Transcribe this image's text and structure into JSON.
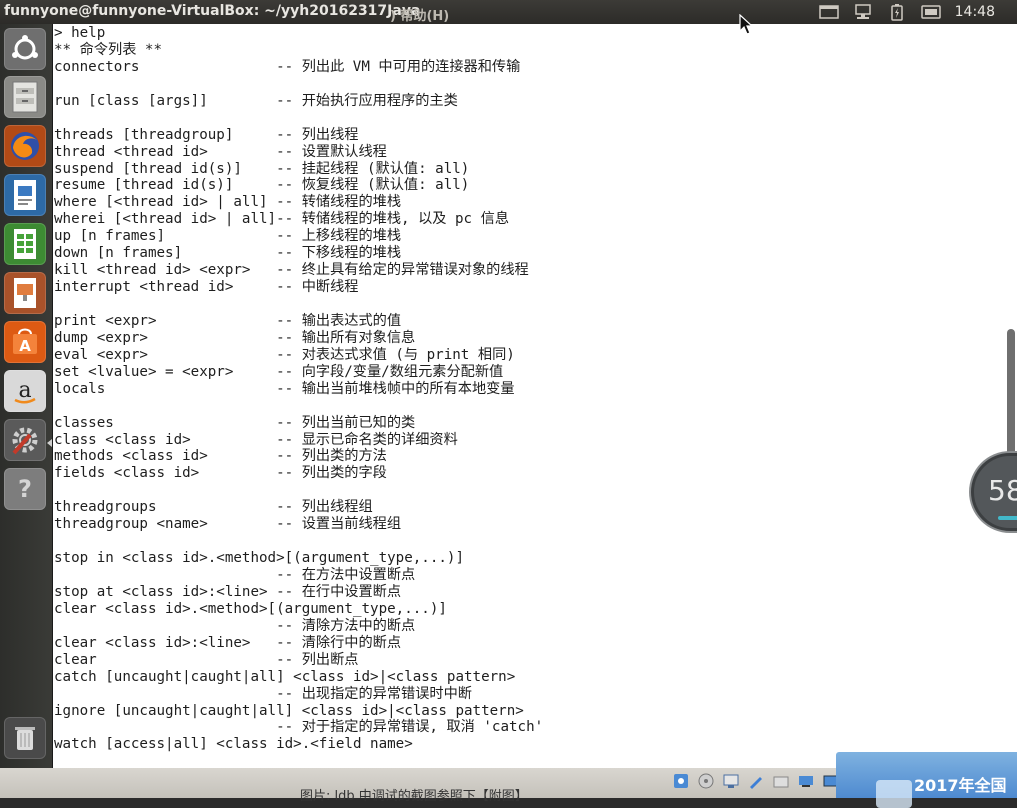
{
  "topbar": {
    "window_title": "funnyone@funnyone-VirtualBox: ~/yyh20162317Java",
    "menu_ghost": ") 帮助(H)",
    "clock": "14:48"
  },
  "terminal": {
    "lines": [
      "> help",
      "** 命令列表 **",
      "connectors                -- 列出此 VM 中可用的连接器和传输",
      "",
      "run [class [args]]        -- 开始执行应用程序的主类",
      "",
      "threads [threadgroup]     -- 列出线程",
      "thread <thread id>        -- 设置默认线程",
      "suspend [thread id(s)]    -- 挂起线程 (默认值: all)",
      "resume [thread id(s)]     -- 恢复线程 (默认值: all)",
      "where [<thread id> | all] -- 转储线程的堆栈",
      "wherei [<thread id> | all]-- 转储线程的堆栈, 以及 pc 信息",
      "up [n frames]             -- 上移线程的堆栈",
      "down [n frames]           -- 下移线程的堆栈",
      "kill <thread id> <expr>   -- 终止具有给定的异常错误对象的线程",
      "interrupt <thread id>     -- 中断线程",
      "",
      "print <expr>              -- 输出表达式的值",
      "dump <expr>               -- 输出所有对象信息",
      "eval <expr>               -- 对表达式求值 (与 print 相同)",
      "set <lvalue> = <expr>     -- 向字段/变量/数组元素分配新值",
      "locals                    -- 输出当前堆栈帧中的所有本地变量",
      "",
      "classes                   -- 列出当前已知的类",
      "class <class id>          -- 显示已命名类的详细资料",
      "methods <class id>        -- 列出类的方法",
      "fields <class id>         -- 列出类的字段",
      "",
      "threadgroups              -- 列出线程组",
      "threadgroup <name>        -- 设置当前线程组",
      "",
      "stop in <class id>.<method>[(argument_type,...)]",
      "                          -- 在方法中设置断点",
      "stop at <class id>:<line> -- 在行中设置断点",
      "clear <class id>.<method>[(argument_type,...)]",
      "                          -- 清除方法中的断点",
      "clear <class id>:<line>   -- 清除行中的断点",
      "clear                     -- 列出断点",
      "catch [uncaught|caught|all] <class id>|<class pattern>",
      "                          -- 出现指定的异常错误时中断",
      "ignore [uncaught|caught|all] <class id>|<class pattern>",
      "                          -- 对于指定的异常错误, 取消 'catch'",
      "watch [access|all] <class id>.<field name>"
    ]
  },
  "widget": {
    "value": "58"
  },
  "bottom": {
    "caption": "图片: ldb 中调试的截图参照下【附图】",
    "banner_text": "2017年全国"
  },
  "launcher": {
    "items": [
      "ubuntu-home-icon",
      "files-icon",
      "firefox-icon",
      "writer-icon",
      "calc-icon",
      "impress-icon",
      "software-center-icon",
      "amazon-icon",
      "settings-icon",
      "help-icon",
      "trash-icon"
    ]
  },
  "colors": {
    "panel": "#3c3b37",
    "launcher": "#2d2e2b",
    "terminal_bg": "#ffffff",
    "terminal_fg": "#1e1e1e",
    "banner": "#4e8ad0"
  }
}
